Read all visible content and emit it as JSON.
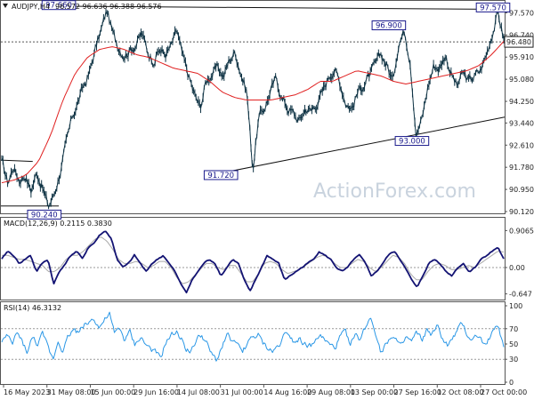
{
  "chart_data": [
    {
      "type": "candlestick",
      "symbol_header": "AUDJPY,H4",
      "ohlc_header": "96.572 96.636 96.388 96.576",
      "price_axis_ticks": [
        "97.570",
        "96.740",
        "95.910",
        "95.080",
        "94.250",
        "93.440",
        "92.610",
        "91.780",
        "90.950",
        "90.120"
      ],
      "ylim": [
        90.12,
        97.85
      ],
      "current_price_label": "96.480",
      "current_price": 96.48,
      "annotations": [
        {
          "text": "97.660",
          "x": "5 Jun 2023",
          "y": 97.66
        },
        {
          "text": "90.240",
          "x": "31 May 2023",
          "y": 90.24
        },
        {
          "text": "91.720",
          "x": "31 Jul 2023",
          "y": 91.72
        },
        {
          "text": "96.900",
          "x": "27 Sep 2023",
          "y": 96.9
        },
        {
          "text": "93.000",
          "x": "5 Oct 2023",
          "y": 93.0
        },
        {
          "text": "97.570",
          "x": "2 Nov 2023",
          "y": 97.57
        }
      ],
      "price_path": [
        92.0,
        91.2,
        91.8,
        91.3,
        91.5,
        90.9,
        91.6,
        91.0,
        90.3,
        90.8,
        91.6,
        92.6,
        93.6,
        94.2,
        94.8,
        95.3,
        96.2,
        96.9,
        97.66,
        96.8,
        96.3,
        96.0,
        96.2,
        96.4,
        96.8,
        96.1,
        95.8,
        96.2,
        96.0,
        96.3,
        96.9,
        95.9,
        95.2,
        94.5,
        94.0,
        95.0,
        95.3,
        95.5,
        95.2,
        95.8,
        96.1,
        95.3,
        94.6,
        91.72,
        93.6,
        94.0,
        94.6,
        95.1,
        94.4,
        94.0,
        93.8,
        93.5,
        94.0,
        93.9,
        94.2,
        94.6,
        95.2,
        95.5,
        94.9,
        94.2,
        94.0,
        94.6,
        94.9,
        95.2,
        95.6,
        96.0,
        95.6,
        95.0,
        96.5,
        96.9,
        95.8,
        93.0,
        93.6,
        94.8,
        95.6,
        95.5,
        96.0,
        95.3,
        94.8,
        95.3,
        95.0,
        95.2,
        95.4,
        96.0,
        96.8,
        97.57,
        96.58
      ],
      "ma_path": [
        91.2,
        91.3,
        91.5,
        92.0,
        93.0,
        94.3,
        95.3,
        95.9,
        96.2,
        96.3,
        96.2,
        96.0,
        95.9,
        95.7,
        95.5,
        95.4,
        95.3,
        95.0,
        94.6,
        94.4,
        94.3,
        94.3,
        94.3,
        94.4,
        94.5,
        94.7,
        95.0,
        95.0,
        95.2,
        95.4,
        95.3,
        95.2,
        95.0,
        94.9,
        95.0,
        95.1,
        95.2,
        95.3,
        95.4,
        95.6,
        96.0,
        96.5
      ],
      "trendlines": [
        {
          "x1": "29 Jul 2023",
          "y1": 91.52,
          "x2": "6 Nov 2023",
          "y2": 93.66
        },
        {
          "x1": "1 Jun 2023",
          "y1": 97.82,
          "x2": "6 Nov 2023",
          "y2": 97.7
        },
        {
          "x1": "16 May 2023",
          "y1": 92.05,
          "x2": "27 May 2023",
          "y2": 92.0
        },
        {
          "x1": "16 May 2023",
          "y1": 90.33,
          "x2": "5 Jun 2023",
          "y2": 90.33
        }
      ],
      "dotted_levels": [
        96.48
      ]
    },
    {
      "type": "line",
      "title": "MACD(12,26,9) 0.2115 0.3830",
      "axis_ticks": [
        "0.9065",
        "0.00",
        "-0.647"
      ],
      "ylim": [
        -0.72,
        0.98
      ],
      "zero_level": 0.0,
      "main_path": [
        0.2,
        0.4,
        0.3,
        0.1,
        0.2,
        0.3,
        -0.1,
        0.1,
        0.2,
        -0.4,
        -0.1,
        0.1,
        0.3,
        0.4,
        0.2,
        0.5,
        0.6,
        0.8,
        0.9,
        0.7,
        0.2,
        0.0,
        0.1,
        0.3,
        0.1,
        -0.1,
        0.1,
        0.2,
        0.3,
        0.1,
        -0.1,
        -0.4,
        -0.6,
        -0.3,
        -0.1,
        0.1,
        0.2,
        0.1,
        -0.2,
        0.0,
        0.2,
        0.1,
        -0.3,
        -0.6,
        -0.3,
        0.0,
        0.3,
        0.2,
        0.1,
        -0.3,
        -0.2,
        -0.1,
        0.0,
        0.1,
        0.2,
        0.4,
        0.3,
        0.2,
        0.0,
        -0.1,
        0.0,
        0.2,
        0.3,
        0.1,
        -0.2,
        -0.1,
        0.1,
        0.3,
        0.4,
        0.2,
        0.0,
        -0.3,
        -0.5,
        -0.2,
        0.1,
        0.2,
        0.1,
        -0.1,
        -0.2,
        0.0,
        0.1,
        -0.1,
        0.0,
        0.2,
        0.3,
        0.4,
        0.5,
        0.2
      ],
      "signal_path": [
        0.3,
        0.3,
        0.25,
        0.2,
        0.2,
        0.15,
        0.1,
        0.05,
        -0.1,
        -0.1,
        0.0,
        0.2,
        0.3,
        0.3,
        0.4,
        0.55,
        0.7,
        0.75,
        0.65,
        0.45,
        0.2,
        0.1,
        0.1,
        0.15,
        0.1,
        0.0,
        0.05,
        0.15,
        0.15,
        0.0,
        -0.25,
        -0.4,
        -0.35,
        -0.2,
        -0.05,
        0.1,
        0.1,
        0.0,
        -0.05,
        0.05,
        0.05,
        -0.15,
        -0.35,
        -0.35,
        -0.15,
        0.1,
        0.15,
        0.1,
        -0.05,
        -0.15,
        -0.1,
        -0.05,
        0.05,
        0.15,
        0.25,
        0.3,
        0.25,
        0.1,
        0.0,
        0.0,
        0.1,
        0.2,
        0.15,
        0.0,
        -0.1,
        0.0,
        0.15,
        0.3,
        0.25,
        0.1,
        -0.15,
        -0.3,
        -0.3,
        -0.1,
        0.05,
        0.1,
        0.05,
        -0.05,
        -0.05,
        0.0,
        0.05,
        0.0,
        0.1,
        0.2,
        0.3,
        0.4,
        0.38
      ]
    },
    {
      "type": "line",
      "title": "RSI(14) 46.3132",
      "axis_ticks": [
        "100",
        "70",
        "50",
        "30",
        "0"
      ],
      "ylim": [
        0,
        100
      ],
      "dotted_levels": [
        70,
        30
      ],
      "path": [
        55,
        60,
        48,
        65,
        52,
        40,
        58,
        50,
        62,
        45,
        30,
        55,
        42,
        60,
        70,
        64,
        75,
        78,
        85,
        72,
        80,
        90,
        62,
        70,
        55,
        65,
        48,
        60,
        50,
        44,
        38,
        30,
        52,
        60,
        66,
        58,
        45,
        40,
        55,
        62,
        50,
        35,
        28,
        48,
        62,
        55,
        46,
        40,
        52,
        58,
        62,
        50,
        44,
        40,
        48,
        60,
        66,
        54,
        58,
        52,
        46,
        50,
        62,
        55,
        48,
        44,
        58,
        66,
        52,
        60,
        56,
        72,
        86,
        66,
        40,
        50,
        62,
        55,
        44,
        58,
        52,
        64,
        54,
        68,
        62,
        72,
        58,
        48,
        55,
        68,
        75,
        60,
        56,
        62,
        50,
        58,
        66,
        72,
        46
      ]
    }
  ],
  "x_axis_labels": [
    "16 May 2023",
    "31 May 08:00",
    "15 Jun 00:00",
    "29 Jun 16:00",
    "14 Jul 08:00",
    "31 Jul 00:00",
    "14 Aug 16:00",
    "29 Aug 08:00",
    "13 Sep 00:00",
    "27 Sep 16:00",
    "12 Oct 08:00",
    "27 Oct 00:00"
  ],
  "watermark": "ActionForex.com",
  "colors": {
    "price_line": "#0f3344",
    "ma": "#e02020",
    "macd_main": "#131373",
    "macd_signal": "#aaaaaa",
    "rsi": "#2a97e6",
    "annotation": "#1a1a8c",
    "grid": "#9a9a9a"
  }
}
